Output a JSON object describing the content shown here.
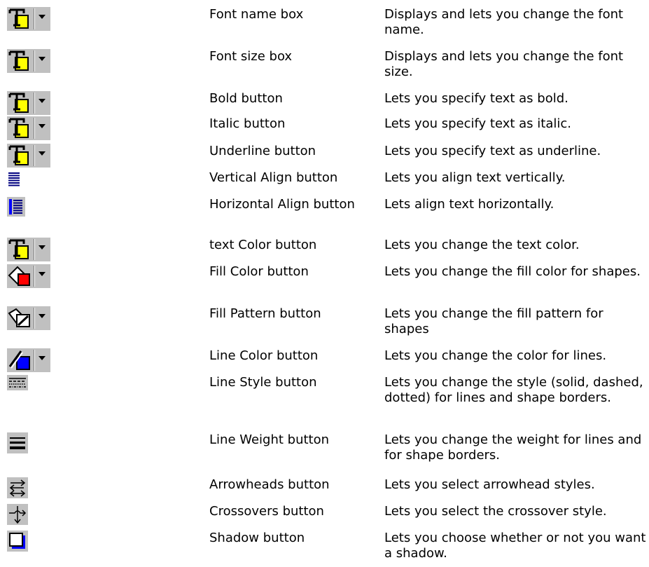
{
  "rows": [
    {
      "icon": "text-color-dropdown-icon",
      "name": "Font name box",
      "desc": "Displays and lets you change the font name."
    },
    {
      "icon": "text-color-dropdown-icon",
      "name": "Font size box",
      "desc": "Displays and lets you change the font size."
    },
    {
      "icon": "text-color-dropdown-icon",
      "name": "Bold button",
      "desc": "Lets you specify text as bold."
    },
    {
      "icon": "text-color-dropdown-icon",
      "name": "Italic button",
      "desc": "Lets you specify text as italic."
    },
    {
      "icon": "text-color-dropdown-icon",
      "name": "Underline button",
      "desc": "Lets you specify text as underline."
    },
    {
      "icon": "vertical-align-icon",
      "name": "Vertical Align button",
      "desc": "Lets you align text vertically."
    },
    {
      "icon": "horizontal-align-icon",
      "name": "Horizontal Align button",
      "desc": "Lets align text horizontally."
    },
    {
      "icon": "text-color-dropdown-icon",
      "name": "text Color button",
      "desc": "Lets you change the text color."
    },
    {
      "icon": "fill-color-dropdown-icon",
      "name": "Fill Color button",
      "desc": "Lets you change the fill color for shapes."
    },
    {
      "icon": "fill-pattern-dropdown-icon",
      "name": "Fill Pattern button",
      "desc": "Lets you change the fill pattern for shapes"
    },
    {
      "icon": "line-color-dropdown-icon",
      "name": "Line Color button",
      "desc": "Lets you change the color for lines."
    },
    {
      "icon": "line-style-icon",
      "name": "Line Style button",
      "desc": "Lets you change the style (solid, dashed, dotted) for lines and shape borders."
    },
    {
      "icon": "line-weight-icon",
      "name": "Line Weight button",
      "desc": "Lets you change the weight for lines and for shape borders."
    },
    {
      "icon": "arrowheads-icon",
      "name": "Arrowheads button",
      "desc": "Lets you select arrowhead styles."
    },
    {
      "icon": "crossovers-icon",
      "name": "Crossovers button",
      "desc": "Lets you select the crossover style."
    },
    {
      "icon": "shadow-icon",
      "name": "Shadow button",
      "desc": "Lets you choose whether or not you want a shadow."
    }
  ]
}
